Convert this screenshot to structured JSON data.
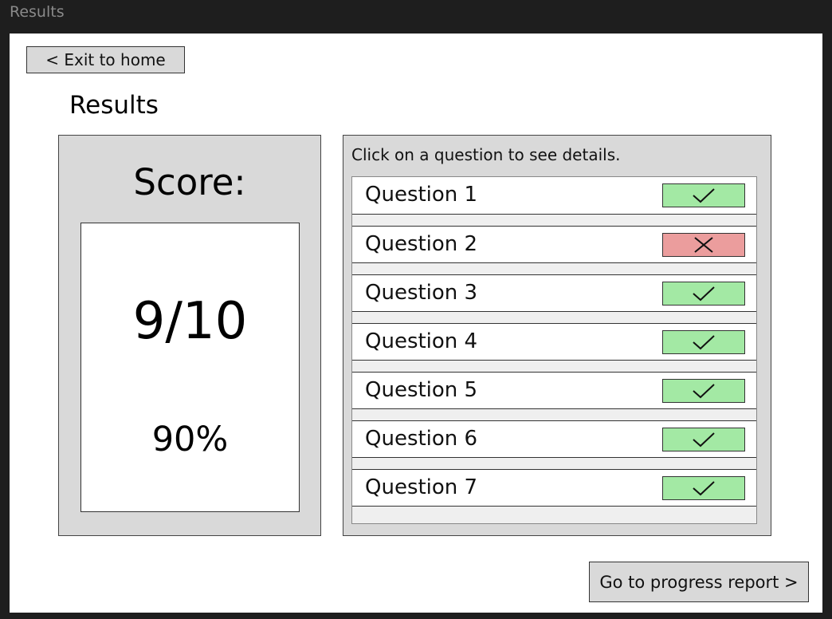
{
  "window": {
    "title": "Results"
  },
  "nav": {
    "exit_label": "< Exit to home",
    "progress_label": "Go to progress report >"
  },
  "page": {
    "title": "Results"
  },
  "score": {
    "label": "Score:",
    "fraction": "9/10",
    "percent": "90%"
  },
  "questions": {
    "hint": "Click on a question to see details.",
    "items": [
      {
        "label": "Question 1",
        "status": "correct"
      },
      {
        "label": "Question 2",
        "status": "incorrect"
      },
      {
        "label": "Question 3",
        "status": "correct"
      },
      {
        "label": "Question 4",
        "status": "correct"
      },
      {
        "label": "Question 5",
        "status": "correct"
      },
      {
        "label": "Question 6",
        "status": "correct"
      },
      {
        "label": "Question 7",
        "status": "correct"
      }
    ]
  },
  "colors": {
    "correct": "#a3e9a4",
    "incorrect": "#eb9d9d"
  }
}
